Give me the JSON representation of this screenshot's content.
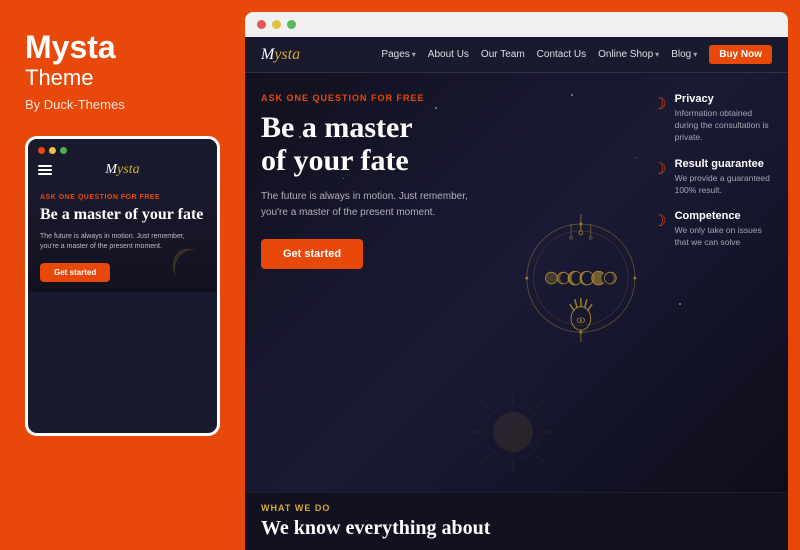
{
  "left": {
    "brand_name": "Mysta",
    "brand_theme": "Theme",
    "brand_by": "By Duck-Themes"
  },
  "mobile": {
    "ask_tag": "ASK ONE QUESTION FOR FREE",
    "hero_title": "Be a master of your fate",
    "hero_desc": "The future is always in motion. Just remember, you're a master of the present moment.",
    "cta_label": "Get started",
    "logo": "Mysta"
  },
  "nav": {
    "logo": "Mysta",
    "links": [
      {
        "label": "Pages",
        "caret": true
      },
      {
        "label": "About Us",
        "caret": false
      },
      {
        "label": "Our Team",
        "caret": false
      },
      {
        "label": "Contact Us",
        "caret": false
      },
      {
        "label": "Online Shop",
        "caret": true
      },
      {
        "label": "Blog",
        "caret": true
      }
    ],
    "buy_btn": "Buy Now"
  },
  "hero": {
    "ask_tag": "ASK ONE QUESTION FOR FREE",
    "title_line1": "Be a master",
    "title_line2": "of your fate",
    "desc": "The future is always in motion. Just remember, you're a master of the present moment.",
    "cta_label": "Get started"
  },
  "features": [
    {
      "title": "Privacy",
      "desc": "Information obtained during the consultation is private."
    },
    {
      "title": "Result guarantee",
      "desc": "We provide a guaranteed 100% result."
    },
    {
      "title": "Competence",
      "desc": "We only take on issues that we can solve"
    }
  ],
  "bottom": {
    "tag": "WHAT WE DO",
    "title": "We know everything about"
  }
}
